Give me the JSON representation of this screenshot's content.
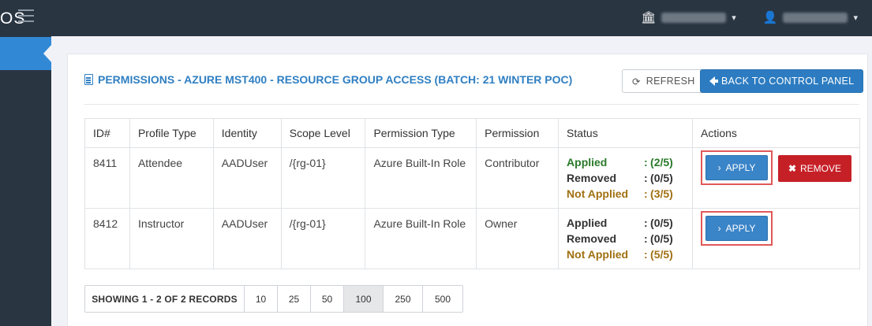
{
  "topbar": {
    "logo_fragment": "OS",
    "org_icon": "institution-icon",
    "user_icon": "user-icon"
  },
  "page": {
    "title": "PERMISSIONS - AZURE MST400 - RESOURCE GROUP ACCESS (BATCH: 21 WINTER POC)",
    "refresh_label": "REFRESH",
    "back_label": "BACK TO CONTROL PANEL"
  },
  "table": {
    "headers": [
      "ID#",
      "Profile Type",
      "Identity",
      "Scope Level",
      "Permission Type",
      "Permission",
      "Status",
      "Actions"
    ],
    "rows": [
      {
        "id": "8411",
        "profile_type": "Attendee",
        "identity": "AADUser",
        "scope_level": "/{rg-01}",
        "permission_type": "Azure Built-In Role",
        "permission": "Contributor",
        "status": {
          "applied_label": "Applied",
          "applied_value": "(2/5)",
          "removed_label": "Removed",
          "removed_value": "(0/5)",
          "not_applied_label": "Not Applied",
          "not_applied_value": "(3/5)"
        },
        "apply_label": "APPLY",
        "remove_label": "REMOVE"
      },
      {
        "id": "8412",
        "profile_type": "Instructor",
        "identity": "AADUser",
        "scope_level": "/{rg-01}",
        "permission_type": "Azure Built-In Role",
        "permission": "Owner",
        "status": {
          "applied_label": "Applied",
          "applied_value": "(0/5)",
          "removed_label": "Removed",
          "removed_value": "(0/5)",
          "not_applied_label": "Not Applied",
          "not_applied_value": "(5/5)"
        },
        "apply_label": "APPLY"
      }
    ]
  },
  "pager": {
    "info": "SHOWING 1 - 2 OF 2 RECORDS",
    "options": [
      "10",
      "25",
      "50",
      "100",
      "250",
      "500"
    ],
    "selected": "100"
  },
  "colors": {
    "nav_bg": "#2a3542",
    "accent": "#2f7fc2",
    "applied": "#2a7a2a",
    "not_applied": "#a07011",
    "remove": "#c62027",
    "highlight_box": "#e0585a"
  },
  "separator": ":"
}
